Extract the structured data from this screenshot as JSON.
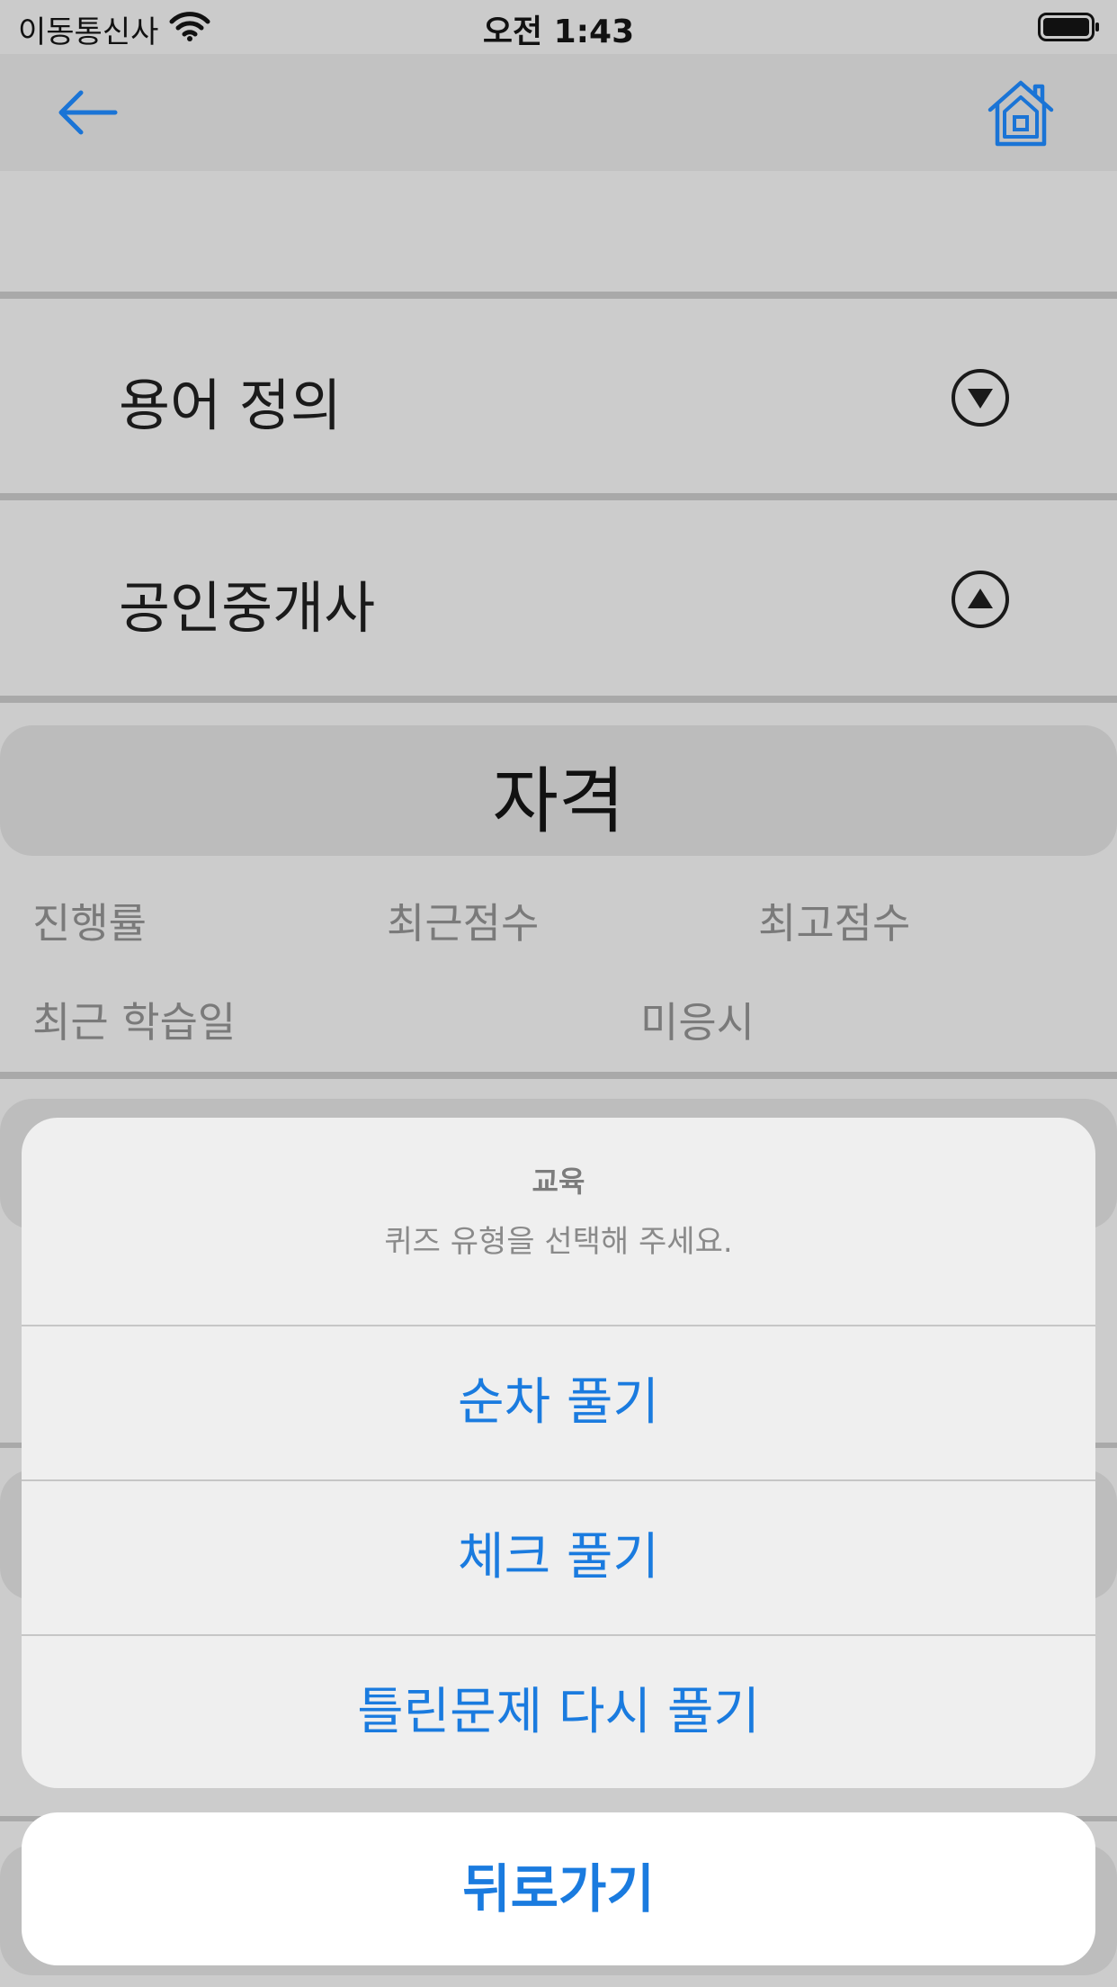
{
  "status_bar": {
    "carrier": "이동통신사",
    "time": "오전 1:43"
  },
  "nav": {
    "back_icon": "back-arrow-icon",
    "home_icon": "home-icon",
    "accent": "#1a74d6"
  },
  "sections": [
    {
      "title": "용어 정의",
      "toggle_icon": "chevron-down-circle-icon"
    },
    {
      "title": "공인중개사",
      "toggle_icon": "chevron-up-circle-icon"
    }
  ],
  "category": {
    "title": "자격",
    "stats": {
      "progress_label": "진행률",
      "recent_score_label": "최근점수",
      "best_score_label": "최고점수",
      "last_study_label": "최근 학습일",
      "last_study_value": "미응시"
    }
  },
  "action_sheet": {
    "title": "교육",
    "message": "퀴즈 유형을 선택해 주세요.",
    "actions": [
      {
        "label": "순차 풀기"
      },
      {
        "label": "체크 풀기"
      },
      {
        "label": "틀린문제 다시 풀기"
      }
    ],
    "cancel_label": "뒤로가기",
    "action_color": "#1a7bdf"
  }
}
